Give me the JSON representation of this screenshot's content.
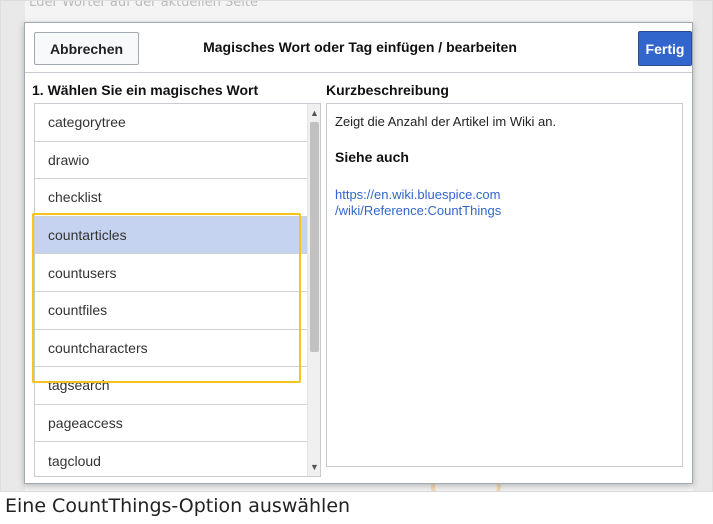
{
  "background": {
    "partial_text": "Lder Worter auf der aktuellen Seite"
  },
  "dialog": {
    "cancel_label": "Abbrechen",
    "title": "Magisches Wort oder Tag einfügen / bearbeiten",
    "done_label": "Fertig"
  },
  "list": {
    "heading": "1. Wählen Sie ein magisches Wort",
    "items": [
      {
        "label": "categorytree"
      },
      {
        "label": "drawio"
      },
      {
        "label": "checklist"
      },
      {
        "label": "countarticles"
      },
      {
        "label": "countusers"
      },
      {
        "label": "countfiles"
      },
      {
        "label": "countcharacters"
      },
      {
        "label": "tagsearch"
      },
      {
        "label": "pageaccess"
      },
      {
        "label": "tagcloud"
      }
    ],
    "selected": "countarticles",
    "scroll_up_icon": "▲",
    "scroll_down_icon": "▼"
  },
  "description": {
    "heading": "Kurzbeschreibung",
    "text": "Zeigt die Anzahl der Artikel im Wiki an.",
    "see_also": "Siehe auch",
    "link_line1": "https://en.wiki.bluespice.com",
    "link_line2": "/wiki/Reference:CountThings"
  },
  "caption": "Eine CountThings-Option auswählen",
  "colors": {
    "accent": "#3366cc",
    "selected_row": "#c5d3f0",
    "highlight": "#f7c41d"
  }
}
